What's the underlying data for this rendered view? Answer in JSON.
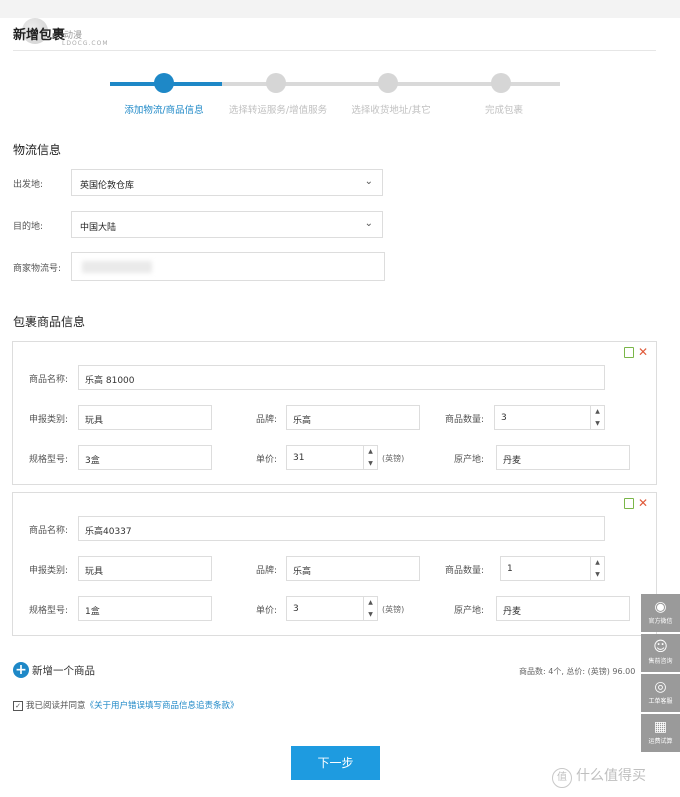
{
  "page": {
    "title": "新增包裹"
  },
  "watermark": {
    "text": "动漫",
    "sub": "LDOCG.COM"
  },
  "steps": [
    {
      "label": "添加物流/商品信息",
      "active": true
    },
    {
      "label": "选择转运服务/增值服务",
      "active": false
    },
    {
      "label": "选择收货地址/其它",
      "active": false
    },
    {
      "label": "完成包裹",
      "active": false
    }
  ],
  "logistics": {
    "title": "物流信息",
    "from_label": "出发地:",
    "from_value": "英国伦敦仓库",
    "to_label": "目的地:",
    "to_value": "中国大陆",
    "tracking_label": "商家物流号:",
    "tracking_value": ""
  },
  "goods": {
    "title": "包裹商品信息",
    "labels": {
      "name": "商品名称:",
      "category": "申报类别:",
      "brand": "品牌:",
      "qty": "商品数量:",
      "model": "规格型号:",
      "price": "单价:",
      "currency": "(英镑)",
      "origin": "原产地:"
    },
    "items": [
      {
        "name": "乐高 81000",
        "category": "玩具",
        "brand": "乐高",
        "qty": "3",
        "model": "3盒",
        "price": "31",
        "origin": "丹麦"
      },
      {
        "name": "乐高40337",
        "category": "玩具",
        "brand": "乐高",
        "qty": "1",
        "model": "1盒",
        "price": "3",
        "origin": "丹麦"
      }
    ]
  },
  "footer": {
    "add_item": "新增一个商品",
    "summary": "商品数: 4个, 总价: (英镑) 96.00",
    "agree_prefix": "我已阅读并同意",
    "agree_link": "《关于用户错误填写商品信息追责条款》",
    "next": "下一步"
  },
  "side_tools": [
    {
      "icon": "wechat-icon",
      "label": "官方微信"
    },
    {
      "icon": "robot-icon",
      "label": "售前咨询"
    },
    {
      "icon": "headset-icon",
      "label": "工单客服"
    },
    {
      "icon": "grid-icon",
      "label": "运费试算"
    }
  ],
  "brand": {
    "logo": "值",
    "text": "什么值得买"
  },
  "colors": {
    "accent": "#1e88c7",
    "button": "#1e9be0"
  }
}
